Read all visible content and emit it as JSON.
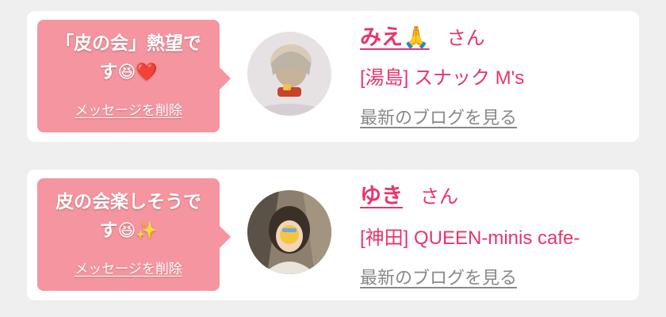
{
  "cards": [
    {
      "message_line1": "「皮の会」熱望で",
      "message_line2": "す",
      "message_emojis": "😆❤️",
      "delete_label": "メッセージを削除",
      "name": "みえ",
      "name_emoji": "🙏",
      "honorific": "さん",
      "shop": "[湯島] スナック M's",
      "blog_link": "最新のブログを見る"
    },
    {
      "message_line1": "皮の会楽しそうで",
      "message_line2": "す",
      "message_emojis": "😆✨",
      "delete_label": "メッセージを削除",
      "name": "ゆき",
      "name_emoji": "",
      "honorific": "さん",
      "shop": "[神田] QUEEN-minis cafe-",
      "blog_link": "最新のブログを見る"
    }
  ],
  "colors": {
    "accent": "#e8346a",
    "bubble": "#f5959f",
    "link_gray": "#888888",
    "background": "#efefef"
  }
}
